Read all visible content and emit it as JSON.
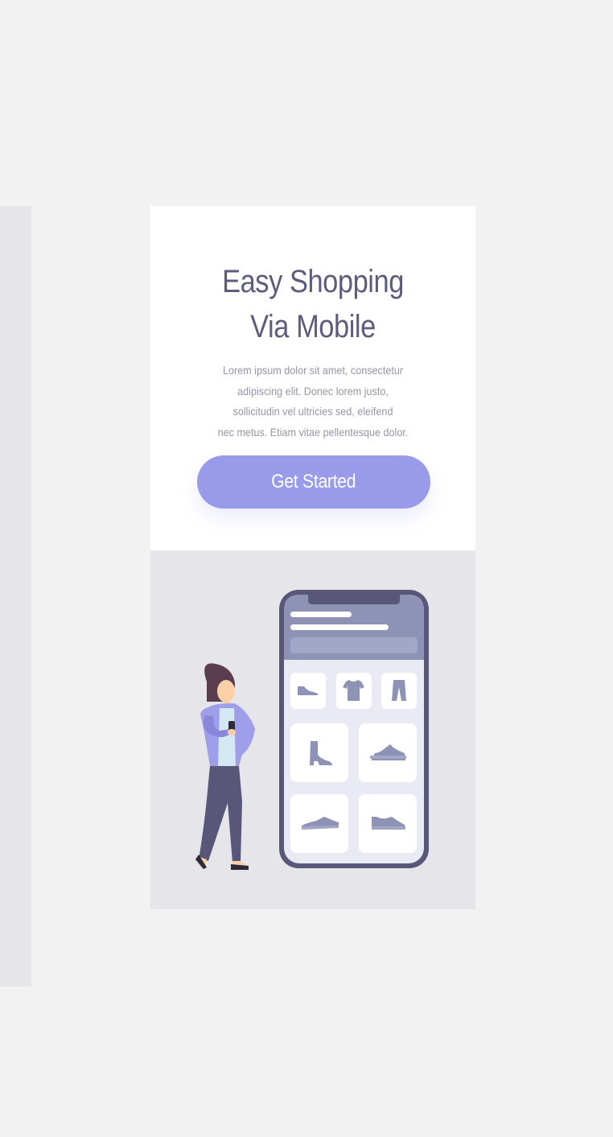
{
  "hero": {
    "title_line1": "Easy Shopping",
    "title_line2": "Via Mobile",
    "description_lines": [
      "Lorem ipsum dolor sit amet, consectetur",
      "adipiscing elit. Donec lorem justo,",
      "sollicitudin vel ultricies sed, eleifend",
      "nec metus. Etiam vitae pellentesque dolor."
    ],
    "cta_label": "Get Started"
  },
  "colors": {
    "page_background": "#f2f2f2",
    "panel_gray": "#e6e5ea",
    "title_text": "#5d5c7d",
    "body_text": "#9695a6",
    "accent": "#979be9",
    "phone_frame": "#585779",
    "phone_header": "#8e92b5",
    "product_icon": "#8e92b5"
  },
  "illustration": {
    "product_icons": [
      "flat-shoe-icon",
      "tshirt-icon",
      "pants-icon",
      "high-heel-boot-icon",
      "sneaker-icon",
      "sneaker-icon",
      "sneaker-icon"
    ]
  }
}
